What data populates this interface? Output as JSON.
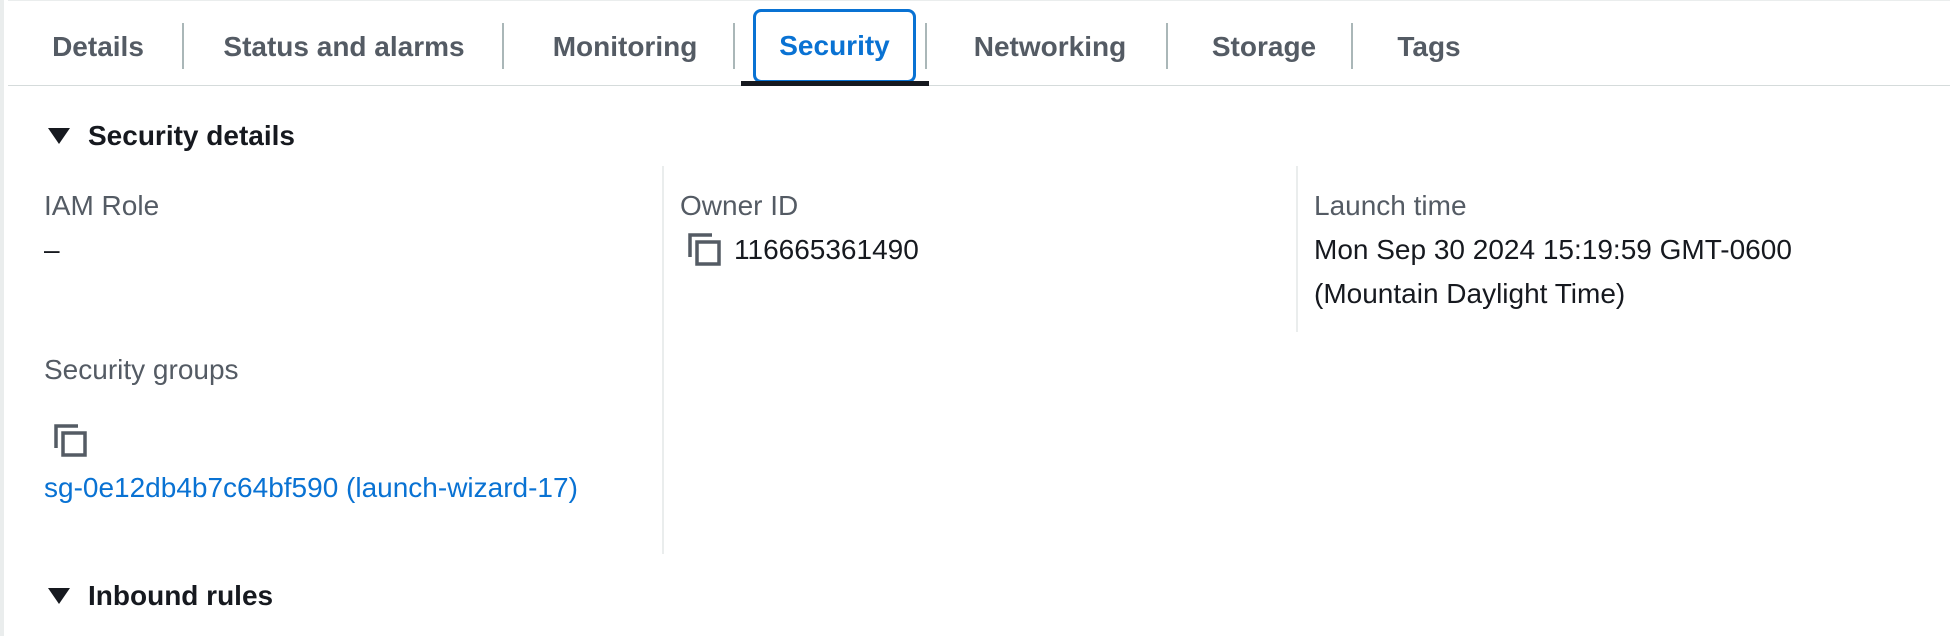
{
  "tabs": [
    {
      "label": "Details",
      "active": false
    },
    {
      "label": "Status and alarms",
      "active": false
    },
    {
      "label": "Monitoring",
      "active": false
    },
    {
      "label": "Security",
      "active": true
    },
    {
      "label": "Networking",
      "active": false
    },
    {
      "label": "Storage",
      "active": false
    },
    {
      "label": "Tags",
      "active": false
    }
  ],
  "security_details": {
    "header": "Security details",
    "iam_role": {
      "label": "IAM Role",
      "value": "–"
    },
    "owner_id": {
      "label": "Owner ID",
      "value": "116665361490"
    },
    "launch_time": {
      "label": "Launch time",
      "value_line1": "Mon Sep 30 2024 15:19:59 GMT-0600",
      "value_line2": "(Mountain Daylight Time)"
    },
    "security_groups": {
      "label": "Security groups",
      "link": "sg-0e12db4b7c64bf590 (launch-wizard-17)"
    }
  },
  "inbound_rules": {
    "header": "Inbound rules"
  },
  "colors": {
    "accent": "#0972d3",
    "text": "#16191f",
    "muted": "#545b64"
  }
}
